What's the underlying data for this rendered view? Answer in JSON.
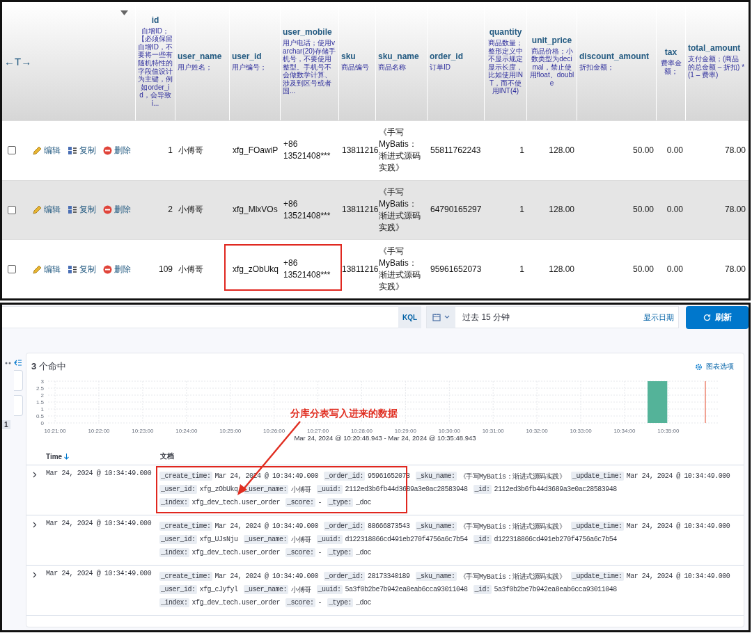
{
  "table": {
    "header_left": {
      "label": "←T→"
    },
    "columns": [
      {
        "name": "id",
        "comment": "自增ID；【必须保留自增ID，不要将一些有随机特性的字段值设计为主键，例如order_id，会导致i..."
      },
      {
        "name": "user_name",
        "comment": "用户姓名；"
      },
      {
        "name": "user_id",
        "comment": "用户编号；"
      },
      {
        "name": "user_mobile",
        "comment": "用户电话；使用varchar(20)存储手机号，不要使用整型。手机号不会做数学计算、涉及到区号或者国..."
      },
      {
        "name": "sku",
        "comment": "商品编号"
      },
      {
        "name": "sku_name",
        "comment": "商品名称"
      },
      {
        "name": "order_id",
        "comment": "订单ID"
      },
      {
        "name": "quantity",
        "comment": "商品数量；整形定义中不显示规定显示长度，比如使用INT，而不使用INT(4)"
      },
      {
        "name": "unit_price",
        "comment": "商品价格；小数类型为decimal，禁止使用float、double"
      },
      {
        "name": "discount_amount",
        "comment": "折扣金额；"
      },
      {
        "name": "tax",
        "comment": "费率金额；"
      },
      {
        "name": "total_amount",
        "comment": "支付金额；(商品的总金额 – 折扣) * (1 – 费率)"
      }
    ],
    "rows": [
      {
        "checked": false,
        "highlighted": false,
        "actions": [
          "编辑",
          "复制",
          "删除"
        ],
        "cells": [
          "1",
          "小傅哥",
          "xfg_FOawiP",
          "+86 13521408***",
          "13811216",
          "《手写MyBatis：渐进式源码实践》",
          "55811762243",
          "1",
          "128.00",
          "50.00",
          "0.00",
          "78.00"
        ]
      },
      {
        "checked": false,
        "highlighted": false,
        "actions": [
          "编辑",
          "复制",
          "删除"
        ],
        "cells": [
          "2",
          "小傅哥",
          "xfg_MlxVOs",
          "+86 13521408***",
          "13811216",
          "《手写MyBatis：渐进式源码实践》",
          "64790165297",
          "1",
          "128.00",
          "50.00",
          "0.00",
          "78.00"
        ]
      },
      {
        "checked": false,
        "highlighted": true,
        "actions": [
          "编辑",
          "复制",
          "删除"
        ],
        "cells": [
          "109",
          "小傅哥",
          "xfg_zObUkq",
          "+86 13521408***",
          "13811216",
          "《手写MyBatis：渐进式源码实践》",
          "95961652073",
          "1",
          "128.00",
          "50.00",
          "0.00",
          "78.00"
        ]
      }
    ]
  },
  "discover": {
    "query_bar": {
      "language": "KQL",
      "time_range": "过去 15 分钟",
      "show_dates": "显示日期",
      "refresh": "刷新"
    },
    "sidebar": {
      "badge": "1"
    },
    "hits": "**3** 个命中",
    "chart_options": "图表选项",
    "histogram": {
      "chart_data": {
        "type": "bar",
        "grid": true,
        "categories": [
          "10:21:00",
          null,
          null,
          null,
          "10:22:00",
          null,
          null,
          null,
          "10:23:00",
          null,
          null,
          null,
          "10:24:00",
          null,
          null,
          null,
          "10:25:00",
          null,
          null,
          null,
          "10:26:00",
          null,
          null,
          null,
          "10:27:00",
          null,
          null,
          null,
          "10:28:00",
          null,
          null,
          null,
          "10:29:00",
          null,
          null,
          null,
          "10:30:00",
          null,
          null,
          null,
          "10:31:00",
          null,
          null,
          null,
          "10:32:00",
          null,
          null,
          null,
          "10:33:00",
          null,
          null,
          null,
          "10:34:00",
          null,
          null,
          null,
          "10:35:00"
        ],
        "values": [
          0,
          0,
          0,
          0,
          0,
          0,
          0,
          0,
          0,
          0,
          0,
          0,
          0,
          0,
          0,
          0,
          0,
          0,
          0,
          0,
          0,
          0,
          0,
          0,
          0,
          0,
          0,
          0,
          0,
          0,
          0,
          0,
          0,
          0,
          0,
          0,
          0,
          0,
          0,
          0,
          0,
          0,
          0,
          0,
          0,
          0,
          0,
          0,
          0,
          0,
          0,
          0,
          0,
          0,
          0,
          3,
          0
        ],
        "ylim": [
          0,
          3
        ],
        "yticks": [
          0,
          0.5,
          1,
          1.5,
          2,
          2.5,
          3
        ]
      },
      "range": "Mar 24, 2024 @ 10:20:48.943 - Mar 24, 2024 @ 10:35:48.943"
    },
    "annotation": "分库分表写入进来的数据",
    "columns": [
      "Time",
      "文档"
    ],
    "docs": [
      {
        "time": "Mar 24, 2024 @ 10:34:49.000",
        "highlighted": true,
        "lines": [
          [
            {
              "key": "_create_time:",
              "value": "Mar 24, 2024 @ 10:34:49.000"
            },
            {
              "key": "_order_id:",
              "value": "95961652073"
            },
            {
              "key": "_sku_name:",
              "value": "《手写MyBatis：渐进式源码实践》"
            },
            {
              "key": "_update_time:",
              "value": "Mar 24, 2024 @ 10:34:49.000"
            }
          ],
          [
            {
              "key": "_user_id:",
              "value": "xfg_zObUkq"
            },
            {
              "key": "_user_name:",
              "value": "小傅哥"
            },
            {
              "key": "_uuid:",
              "value": "2112ed3b6fb44d3689a3e0ac28583948"
            },
            {
              "key": "_id:",
              "value": "2112ed3b6fb44d3689a3e0ac28583948"
            }
          ],
          [
            {
              "key": "_index:",
              "value": "xfg_dev_tech.user_order"
            },
            {
              "key": "_score:",
              "value": "-"
            },
            {
              "key": "_type:",
              "value": "_doc"
            }
          ]
        ]
      },
      {
        "time": "Mar 24, 2024 @ 10:34:49.000",
        "highlighted": false,
        "lines": [
          [
            {
              "key": "_create_time:",
              "value": "Mar 24, 2024 @ 10:34:49.000"
            },
            {
              "key": "_order_id:",
              "value": "88666873543"
            },
            {
              "key": "_sku_name:",
              "value": "《手写MyBatis：渐进式源码实践》"
            },
            {
              "key": "_update_time:",
              "value": "Mar 24, 2024 @ 10:34:49.000"
            }
          ],
          [
            {
              "key": "_user_id:",
              "value": "xfg_UJsNju"
            },
            {
              "key": "_user_name:",
              "value": "小傅哥"
            },
            {
              "key": "_uuid:",
              "value": "d122318866cd491eb270f4756a6c7b54"
            },
            {
              "key": "_id:",
              "value": "d122318866cd491eb270f4756a6c7b54"
            }
          ],
          [
            {
              "key": "_index:",
              "value": "xfg_dev_tech.user_order"
            },
            {
              "key": "_score:",
              "value": "-"
            },
            {
              "key": "_type:",
              "value": "_doc"
            }
          ]
        ]
      },
      {
        "time": "Mar 24, 2024 @ 10:34:49.000",
        "highlighted": false,
        "lines": [
          [
            {
              "key": "_create_time:",
              "value": "Mar 24, 2024 @ 10:34:49.000"
            },
            {
              "key": "_order_id:",
              "value": "28173340189"
            },
            {
              "key": "_sku_name:",
              "value": "《手写MyBatis：渐进式源码实践》"
            },
            {
              "key": "_update_time:",
              "value": "Mar 24, 2024 @ 10:34:49.000"
            }
          ],
          [
            {
              "key": "_user_id:",
              "value": "xfg_cJyfyl"
            },
            {
              "key": "_user_name:",
              "value": "小傅哥"
            },
            {
              "key": "_uuid:",
              "value": "5a3f0b2be7b942ea8eab6cca93011048"
            },
            {
              "key": "_id:",
              "value": "5a3f0b2be7b942ea8eab6cca93011048"
            }
          ],
          [
            {
              "key": "_index:",
              "value": "xfg_dev_tech.user_order"
            },
            {
              "key": "_score:",
              "value": "-"
            },
            {
              "key": "_type:",
              "value": "_doc"
            }
          ]
        ]
      }
    ]
  }
}
